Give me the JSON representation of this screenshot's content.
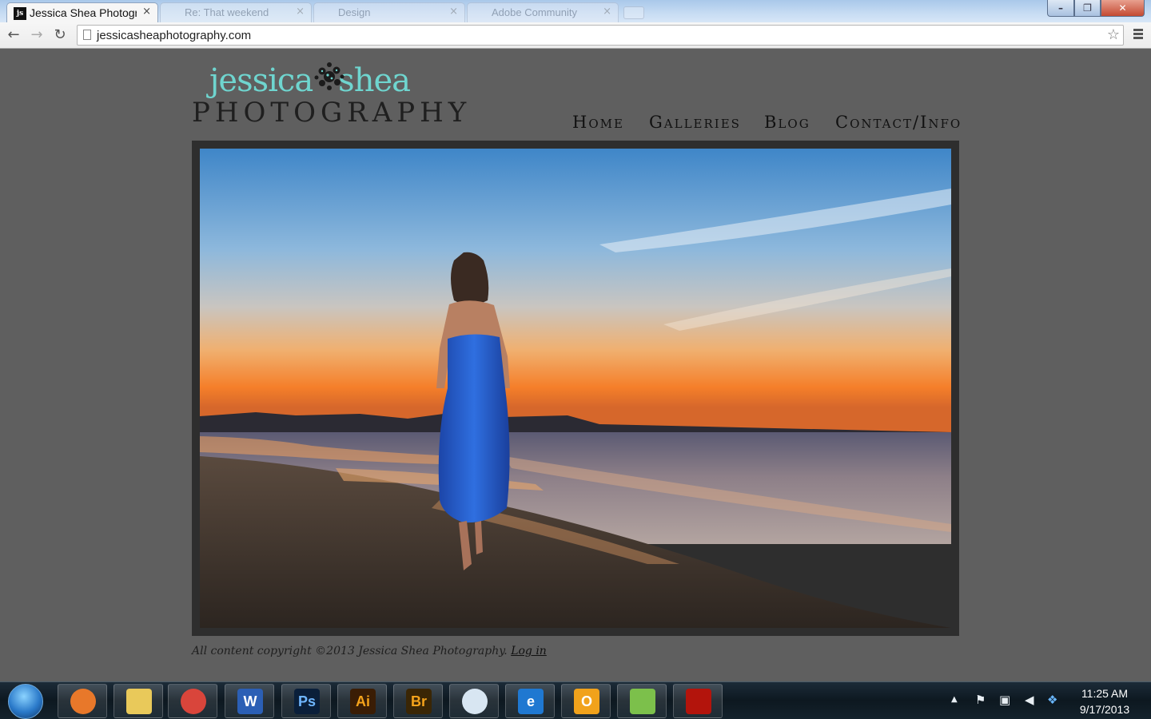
{
  "browser": {
    "active_tab": {
      "favicon": "js",
      "title": "Jessica Shea Photogr",
      "close": "×"
    },
    "background_tabs": [
      {
        "title": "Re: That weekend",
        "close": "×"
      },
      {
        "title": "Design",
        "close": "×"
      },
      {
        "title": "Adobe Community",
        "close": "×"
      }
    ],
    "window_controls": {
      "min": "–",
      "max": "❐",
      "close": "✕"
    },
    "nav": {
      "back": "←",
      "forward": "→",
      "reload": "↻"
    },
    "url": "jessicasheaphotography.com",
    "bookmark_star": "☆",
    "icons": [
      "page-icon",
      "star-icon",
      "menu-icon"
    ]
  },
  "site": {
    "logo_script_left": "jessica",
    "logo_script_right": "shea",
    "logo_word": "PHOTOGRAPHY",
    "nav": [
      "Home",
      "Galleries",
      "Blog",
      "Contact/Info"
    ],
    "footer_text": "All content copyright ©2013 Jessica Shea Photography.",
    "footer_link": "Log in",
    "colors": {
      "background": "#5f5f5f",
      "logo_accent": "#6fd5cf",
      "frame": "#2e2e2e"
    }
  },
  "taskbar": {
    "apps": [
      {
        "name": "firefox",
        "glyph": "",
        "bg": "#e8782a"
      },
      {
        "name": "explorer",
        "glyph": "",
        "bg": "#e9c95a"
      },
      {
        "name": "chrome",
        "glyph": "",
        "bg": "#d9453b"
      },
      {
        "name": "word",
        "glyph": "W",
        "bg": "#2b5fb5"
      },
      {
        "name": "photoshop",
        "glyph": "Ps",
        "bg": "#0a1f3a"
      },
      {
        "name": "illustrator",
        "glyph": "Ai",
        "bg": "#3a1d05"
      },
      {
        "name": "bridge",
        "glyph": "Br",
        "bg": "#3a2605"
      },
      {
        "name": "safari",
        "glyph": "",
        "bg": "#d8e6f2"
      },
      {
        "name": "internet-explorer",
        "glyph": "e",
        "bg": "#1f78d1"
      },
      {
        "name": "outlook",
        "glyph": "O",
        "bg": "#f1a21b"
      },
      {
        "name": "evernote",
        "glyph": "",
        "bg": "#7cc04b"
      },
      {
        "name": "acrobat",
        "glyph": "",
        "bg": "#b3140c"
      }
    ],
    "tray": {
      "arrow": "▲",
      "flag": "⚑",
      "network": "▣",
      "volume": "◀",
      "dropbox": "❖"
    },
    "time": "11:25 AM",
    "date": "9/17/2013"
  }
}
